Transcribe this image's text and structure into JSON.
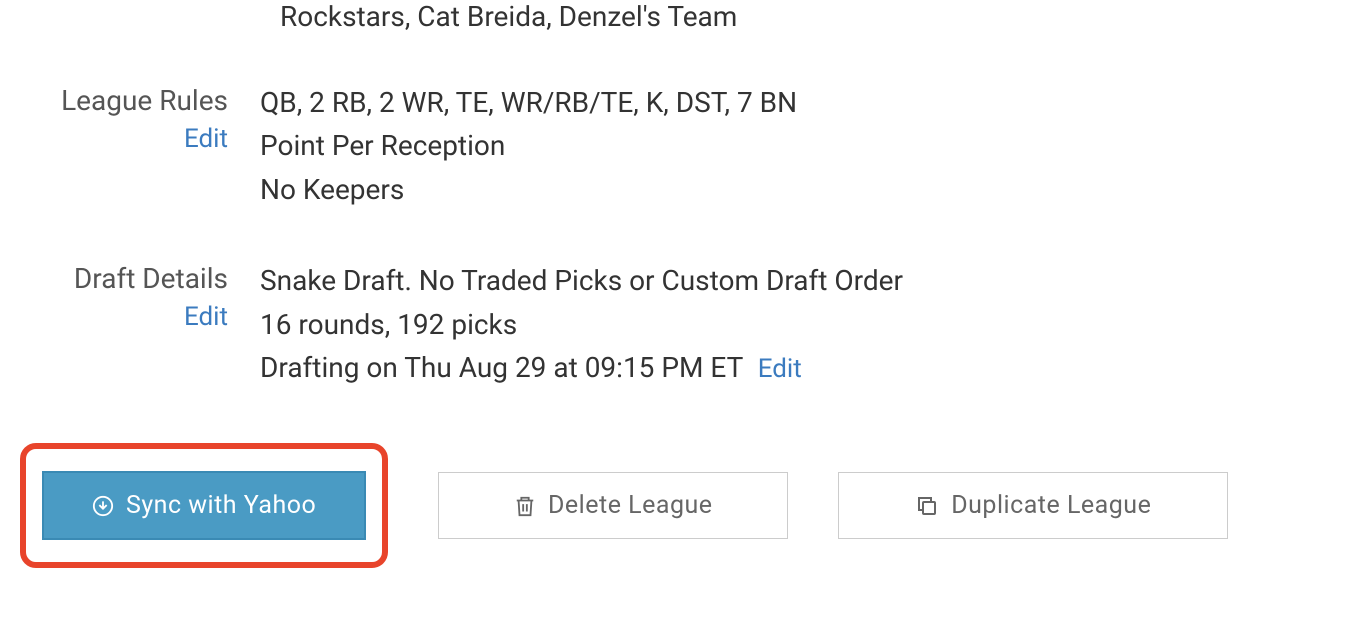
{
  "teams": {
    "partial_text": "Rockstars, Cat Breida, Denzel's Team"
  },
  "league_rules": {
    "label": "League Rules",
    "edit_label": "Edit",
    "lines": [
      "QB, 2 RB, 2 WR, TE, WR/RB/TE, K, DST, 7 BN",
      "Point Per Reception",
      "No Keepers"
    ]
  },
  "draft_details": {
    "label": "Draft Details",
    "edit_label": "Edit",
    "line1": "Snake Draft. No Traded Picks or Custom Draft Order",
    "line2": "16 rounds, 192 picks",
    "line3": "Drafting on Thu Aug 29 at 09:15 PM ET",
    "inline_edit_label": "Edit"
  },
  "buttons": {
    "sync": "Sync with Yahoo",
    "delete": "Delete League",
    "duplicate": "Duplicate League"
  }
}
